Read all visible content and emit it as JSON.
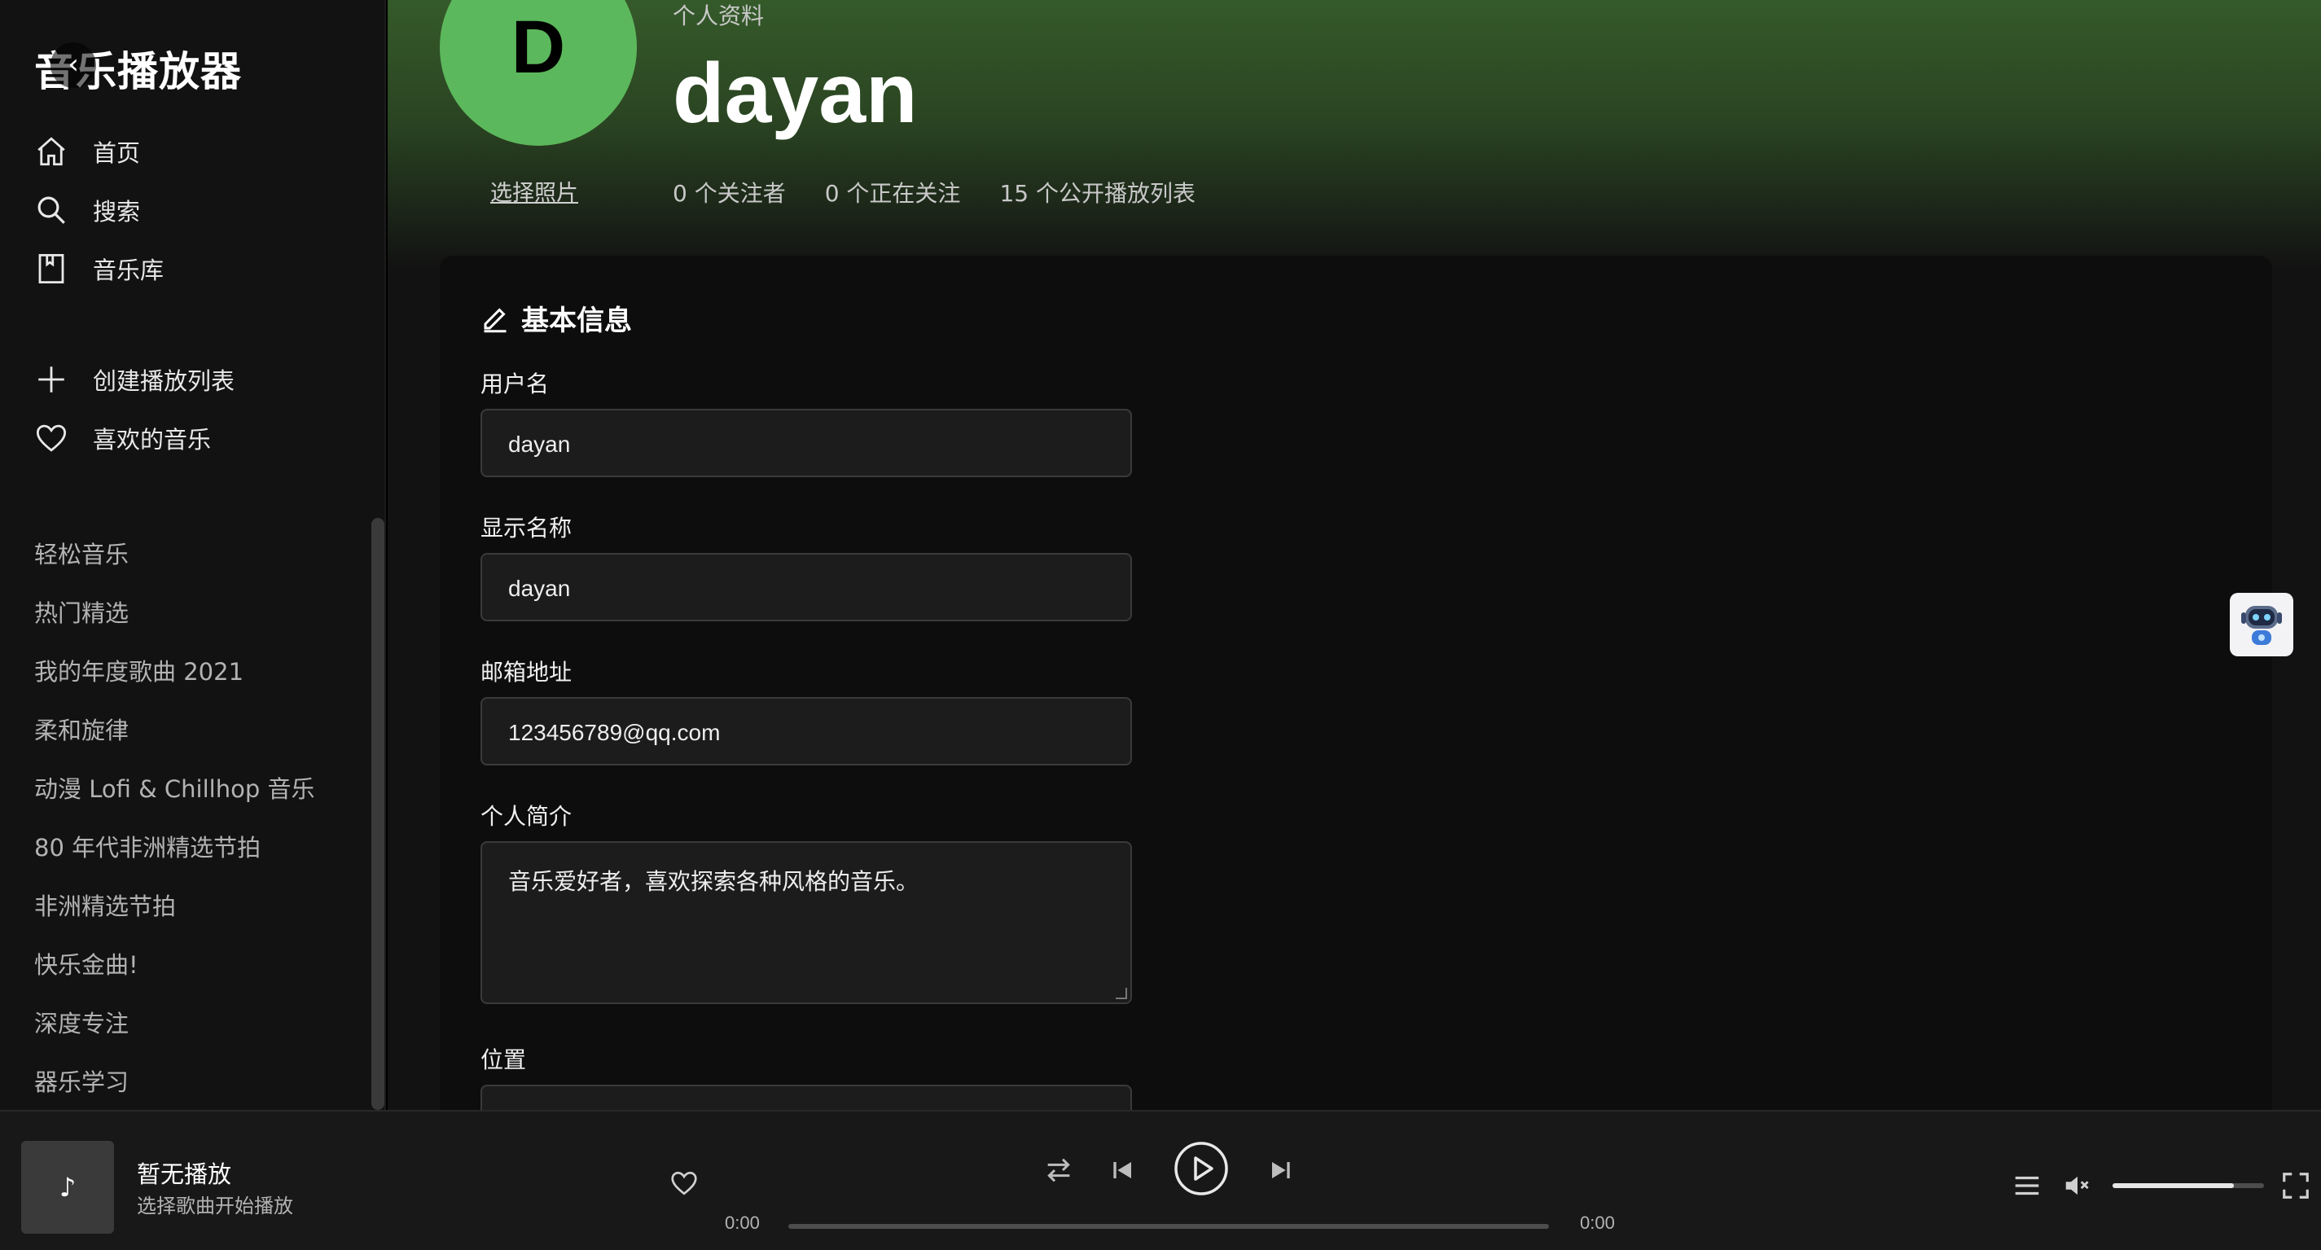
{
  "app": {
    "title": "音乐播放器",
    "back_glyph": "‹"
  },
  "nav": {
    "home": "首页",
    "search": "搜索",
    "library": "音乐库",
    "create_playlist": "创建播放列表",
    "liked_music": "喜欢的音乐"
  },
  "playlists": [
    "轻松音乐",
    "热门精选",
    "我的年度歌曲 2021",
    "柔和旋律",
    "动漫 Lofi & Chillhop 音乐",
    "80 年代非洲精选节拍",
    "非洲精选节拍",
    "快乐金曲!",
    "深度专注",
    "器乐学习"
  ],
  "profile": {
    "avatar_letter": "D",
    "avatar_color": "#5cb85c",
    "choose_photo": "选择照片",
    "type_label": "个人资料",
    "name": "dayan",
    "followers": "0 个关注者",
    "following": "0 个正在关注",
    "public_playlists": "15 个公开播放列表"
  },
  "form": {
    "section_title": "基本信息",
    "username_label": "用户名",
    "username_value": "dayan",
    "display_name_label": "显示名称",
    "display_name_value": "dayan",
    "email_label": "邮箱地址",
    "email_value": "123456789@qq.com",
    "bio_label": "个人简介",
    "bio_value": "音乐爱好者，喜欢探索各种风格的音乐。",
    "location_label": "位置"
  },
  "player": {
    "cover_glyph": "♪",
    "track_title": "暂无播放",
    "track_subtitle": "选择歌曲开始播放",
    "time_current": "0:00",
    "time_total": "0:00",
    "progress_fraction": 0,
    "volume_fraction": 0.8
  },
  "colors": {
    "accent_green": "#5cb85c",
    "header_gradient": "#355a2a",
    "sidebar_bg": "#121212"
  },
  "icons": [
    "home-icon",
    "search-icon",
    "library-icon",
    "plus-icon",
    "heart-icon",
    "edit-icon",
    "shuffle-icon",
    "previous-icon",
    "play-icon",
    "next-icon",
    "queue-icon",
    "volume-icon",
    "fullscreen-icon",
    "robot-assistant-icon"
  ]
}
